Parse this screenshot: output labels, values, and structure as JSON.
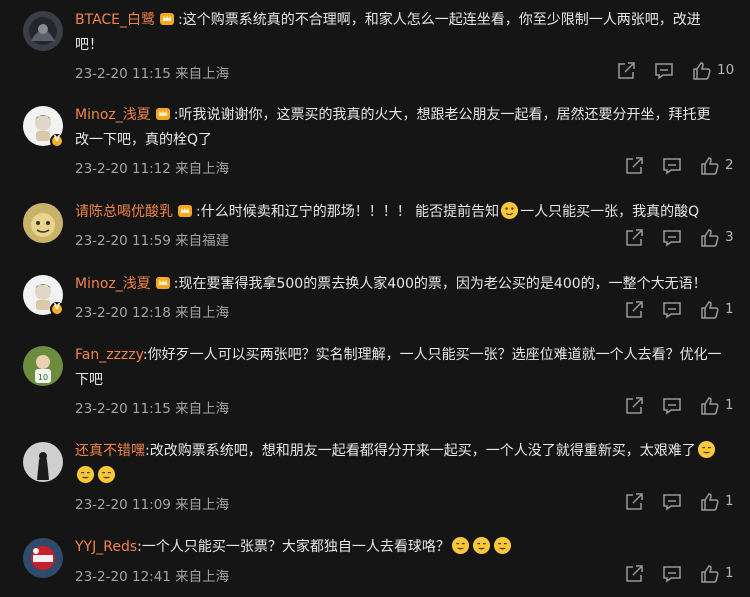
{
  "comments": [
    {
      "user": "BTACE_白鹭",
      "crown": true,
      "text_lines": [
        ":这个购票系统真的不合理啊，和家人怎么一起连坐看，你至少限制一人两张吧，改进",
        "吧！"
      ],
      "meta": "23-2-20 11:15 来自上海",
      "likes": "10",
      "verified": false
    },
    {
      "user": "Minoz_浅夏",
      "crown": true,
      "text_lines": [
        ":听我说谢谢你，这票买的我真的火大，想跟老公朋友一起看，居然还要分开坐，拜托更",
        "改一下吧，真的栓Q了"
      ],
      "meta": "23-2-20 11:12 来自上海",
      "likes": "2",
      "verified": true
    },
    {
      "user": "请陈总喝优酸乳",
      "crown": true,
      "text_lines": [
        ":什么时候卖和辽宁的那场！！！！ 能否提前告知",
        "一人只能买一张，我真的酸Q"
      ],
      "meta": "23-2-20 11:59 来自福建",
      "likes": "3",
      "verified": false
    },
    {
      "user": "Minoz_浅夏",
      "crown": true,
      "text_lines": [
        ":现在要害得我拿500的票去换人家400的票，因为老公买的是400的，一整个大无语！"
      ],
      "meta": "23-2-20 12:18 来自上海",
      "likes": "1",
      "verified": true
    },
    {
      "user": "Fan_zzzzy",
      "crown": false,
      "text_lines": [
        ":你好歹一人可以买两张吧？实名制理解，一人只能买一张？选座位难道就一个人去看？优化一",
        "下吧"
      ],
      "meta": "23-2-20 11:15 来自上海",
      "likes": "1",
      "verified": false
    },
    {
      "user": "还真不错嘿",
      "crown": false,
      "text_lines": [
        ":改改购票系统吧，想和朋友一起看都得分开来一起买，一个人没了就得重新买，太艰难了"
      ],
      "meta": "23-2-20 11:09 来自上海",
      "likes": "1",
      "verified": false
    },
    {
      "user": "YYJ_Reds",
      "crown": false,
      "text_lines": [
        ":一个人只能买一张票？大家都独自一人去看球咯？"
      ],
      "meta": "23-2-20 12:41 来自上海",
      "likes": "1",
      "verified": false
    }
  ],
  "icons": {
    "share": "share-icon",
    "comment": "comment-icon",
    "like": "thumbs-up-icon",
    "crown": "crown-icon",
    "emoji": "emoji-icon"
  },
  "colors": {
    "background": "#151515",
    "username": "#f0834b",
    "text": "#e6e6e6",
    "meta": "#a3a3a3",
    "icon": "#9a9a9a"
  }
}
